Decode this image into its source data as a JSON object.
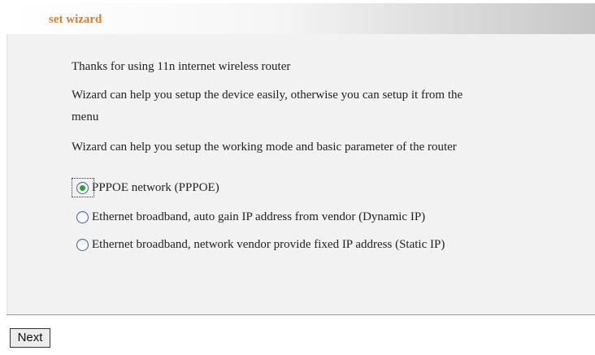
{
  "header": {
    "title": "set wizard"
  },
  "intro": {
    "line1": "Thanks for using 11n internet wireless router",
    "line2a": "Wizard can help you setup the device easily, otherwise you can setup it from the",
    "line2b": "menu",
    "line3": "Wizard can help you setup the working mode and basic parameter of the router"
  },
  "options": [
    {
      "label": "PPPOE network (PPPOE)",
      "selected": true
    },
    {
      "label": "Ethernet broadband, auto gain IP address from vendor (Dynamic IP)",
      "selected": false
    },
    {
      "label": "Ethernet broadband, network vendor provide fixed IP address (Static IP)",
      "selected": false
    }
  ],
  "footer": {
    "next_label": "Next"
  },
  "colors": {
    "title": "#e37a2c",
    "radio_selected": "#2e9e3a",
    "panel_background": "#f2f2f2"
  }
}
